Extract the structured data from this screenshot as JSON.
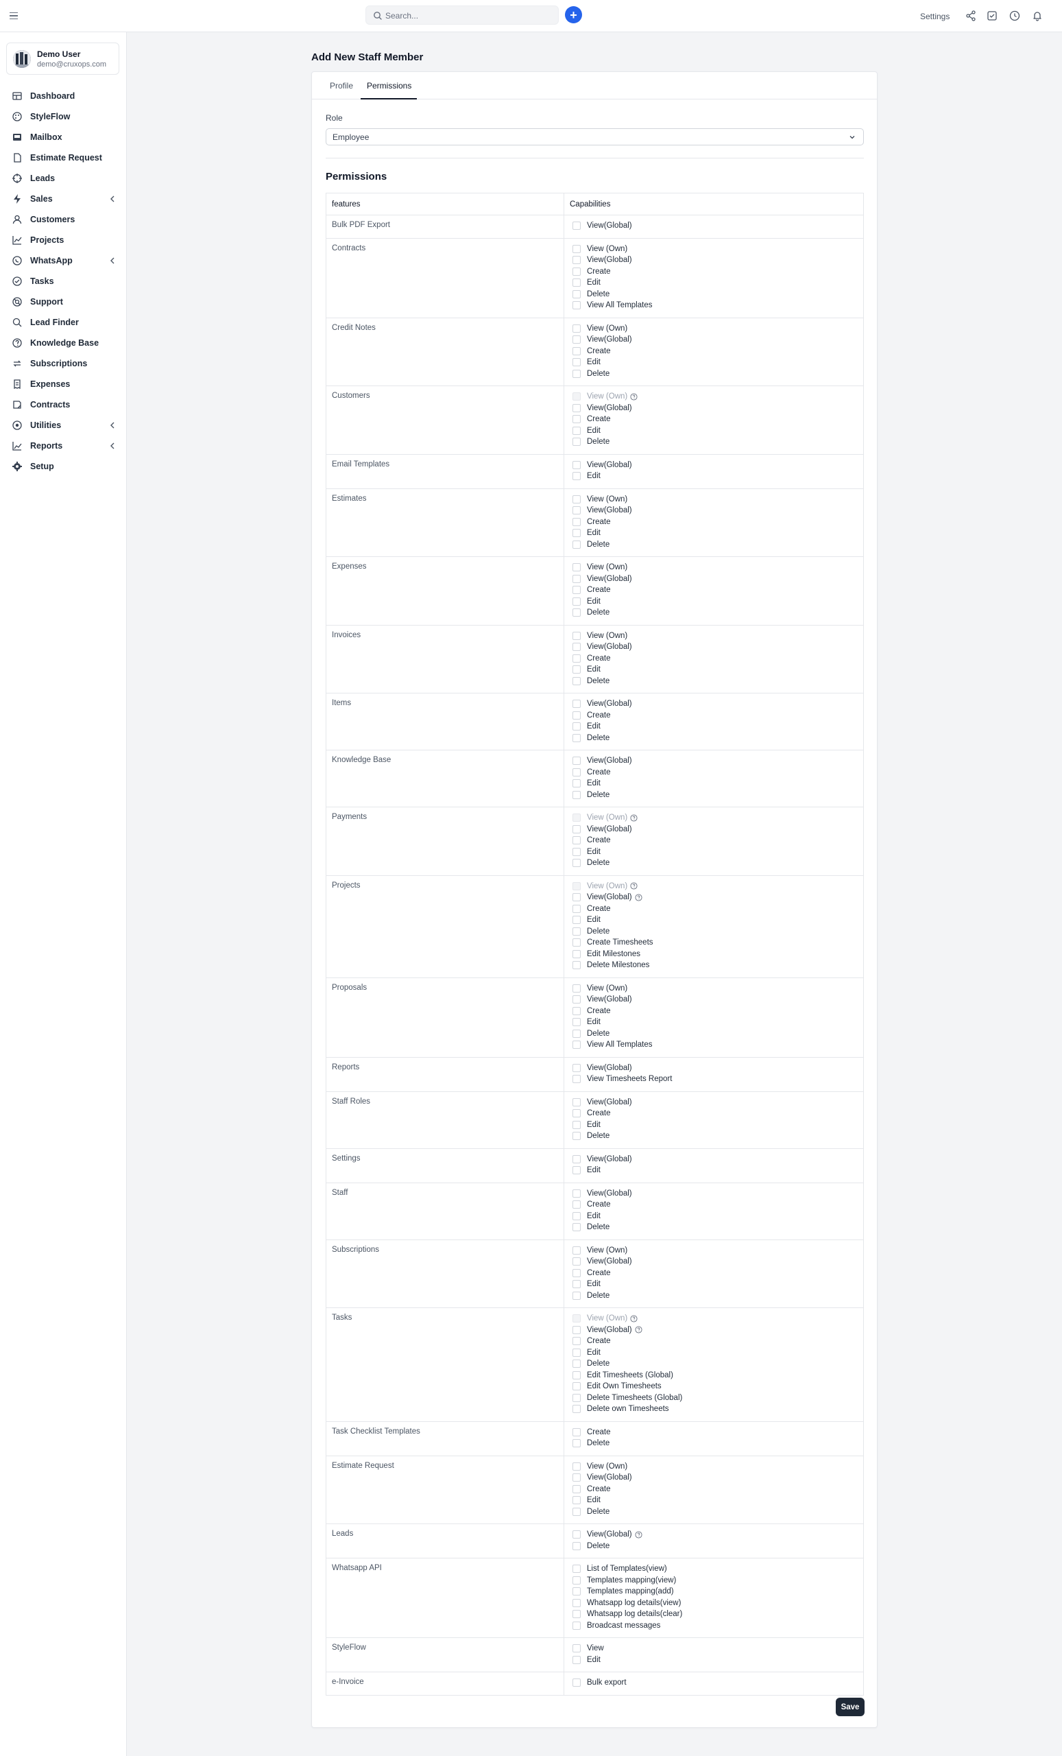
{
  "topbar": {
    "search_placeholder": "Search...",
    "settings_label": "Settings"
  },
  "user": {
    "name": "Demo User",
    "email": "demo@cruxops.com"
  },
  "sidebar": {
    "items": [
      {
        "label": "Dashboard",
        "icon": "dashboard-icon",
        "chevron": false
      },
      {
        "label": "StyleFlow",
        "icon": "palette-icon",
        "chevron": false
      },
      {
        "label": "Mailbox",
        "icon": "inbox-icon",
        "chevron": false
      },
      {
        "label": "Estimate Request",
        "icon": "file-icon",
        "chevron": false
      },
      {
        "label": "Leads",
        "icon": "target-icon",
        "chevron": false
      },
      {
        "label": "Sales",
        "icon": "bolt-icon",
        "chevron": true
      },
      {
        "label": "Customers",
        "icon": "user-icon",
        "chevron": false
      },
      {
        "label": "Projects",
        "icon": "chart-icon",
        "chevron": false
      },
      {
        "label": "WhatsApp",
        "icon": "whatsapp-icon",
        "chevron": true
      },
      {
        "label": "Tasks",
        "icon": "check-circle-icon",
        "chevron": false
      },
      {
        "label": "Support",
        "icon": "lifebuoy-icon",
        "chevron": false
      },
      {
        "label": "Lead Finder",
        "icon": "search-icon",
        "chevron": false
      },
      {
        "label": "Knowledge Base",
        "icon": "help-circle-icon",
        "chevron": false
      },
      {
        "label": "Subscriptions",
        "icon": "repeat-icon",
        "chevron": false
      },
      {
        "label": "Expenses",
        "icon": "receipt-icon",
        "chevron": false
      },
      {
        "label": "Contracts",
        "icon": "contract-icon",
        "chevron": false
      },
      {
        "label": "Utilities",
        "icon": "circle-dot-icon",
        "chevron": true
      },
      {
        "label": "Reports",
        "icon": "line-chart-icon",
        "chevron": true
      },
      {
        "label": "Setup",
        "icon": "gear-icon",
        "chevron": false
      }
    ]
  },
  "page": {
    "title": "Add New Staff Member",
    "tabs": [
      {
        "label": "Profile",
        "active": false
      },
      {
        "label": "Permissions",
        "active": true
      }
    ],
    "role_label": "Role",
    "role_value": "Employee",
    "permissions_title": "Permissions",
    "table_headers": {
      "features": "features",
      "capabilities": "Capabilities"
    },
    "save_label": "Save"
  },
  "permissions": [
    {
      "feature": "Bulk PDF Export",
      "caps": [
        {
          "label": "View(Global)"
        }
      ]
    },
    {
      "feature": "Contracts",
      "caps": [
        {
          "label": "View (Own)"
        },
        {
          "label": "View(Global)"
        },
        {
          "label": "Create"
        },
        {
          "label": "Edit"
        },
        {
          "label": "Delete"
        },
        {
          "label": "View All Templates"
        }
      ]
    },
    {
      "feature": "Credit Notes",
      "caps": [
        {
          "label": "View (Own)"
        },
        {
          "label": "View(Global)"
        },
        {
          "label": "Create"
        },
        {
          "label": "Edit"
        },
        {
          "label": "Delete"
        }
      ]
    },
    {
      "feature": "Customers",
      "caps": [
        {
          "label": "View (Own)",
          "disabled": true,
          "help": true
        },
        {
          "label": "View(Global)"
        },
        {
          "label": "Create"
        },
        {
          "label": "Edit"
        },
        {
          "label": "Delete"
        }
      ]
    },
    {
      "feature": "Email Templates",
      "caps": [
        {
          "label": "View(Global)"
        },
        {
          "label": "Edit"
        }
      ]
    },
    {
      "feature": "Estimates",
      "caps": [
        {
          "label": "View (Own)"
        },
        {
          "label": "View(Global)"
        },
        {
          "label": "Create"
        },
        {
          "label": "Edit"
        },
        {
          "label": "Delete"
        }
      ]
    },
    {
      "feature": "Expenses",
      "caps": [
        {
          "label": "View (Own)"
        },
        {
          "label": "View(Global)"
        },
        {
          "label": "Create"
        },
        {
          "label": "Edit"
        },
        {
          "label": "Delete"
        }
      ]
    },
    {
      "feature": "Invoices",
      "caps": [
        {
          "label": "View (Own)"
        },
        {
          "label": "View(Global)"
        },
        {
          "label": "Create"
        },
        {
          "label": "Edit"
        },
        {
          "label": "Delete"
        }
      ]
    },
    {
      "feature": "Items",
      "caps": [
        {
          "label": "View(Global)"
        },
        {
          "label": "Create"
        },
        {
          "label": "Edit"
        },
        {
          "label": "Delete"
        }
      ]
    },
    {
      "feature": "Knowledge Base",
      "caps": [
        {
          "label": "View(Global)"
        },
        {
          "label": "Create"
        },
        {
          "label": "Edit"
        },
        {
          "label": "Delete"
        }
      ]
    },
    {
      "feature": "Payments",
      "caps": [
        {
          "label": "View (Own)",
          "disabled": true,
          "help": true
        },
        {
          "label": "View(Global)"
        },
        {
          "label": "Create"
        },
        {
          "label": "Edit"
        },
        {
          "label": "Delete"
        }
      ]
    },
    {
      "feature": "Projects",
      "caps": [
        {
          "label": "View (Own)",
          "disabled": true,
          "help": true
        },
        {
          "label": "View(Global)",
          "help": true
        },
        {
          "label": "Create"
        },
        {
          "label": "Edit"
        },
        {
          "label": "Delete"
        },
        {
          "label": "Create Timesheets"
        },
        {
          "label": "Edit Milestones"
        },
        {
          "label": "Delete Milestones"
        }
      ]
    },
    {
      "feature": "Proposals",
      "caps": [
        {
          "label": "View (Own)"
        },
        {
          "label": "View(Global)"
        },
        {
          "label": "Create"
        },
        {
          "label": "Edit"
        },
        {
          "label": "Delete"
        },
        {
          "label": "View All Templates"
        }
      ]
    },
    {
      "feature": "Reports",
      "caps": [
        {
          "label": "View(Global)"
        },
        {
          "label": "View Timesheets Report"
        }
      ]
    },
    {
      "feature": "Staff Roles",
      "caps": [
        {
          "label": "View(Global)"
        },
        {
          "label": "Create"
        },
        {
          "label": "Edit"
        },
        {
          "label": "Delete"
        }
      ]
    },
    {
      "feature": "Settings",
      "caps": [
        {
          "label": "View(Global)"
        },
        {
          "label": "Edit"
        }
      ]
    },
    {
      "feature": "Staff",
      "caps": [
        {
          "label": "View(Global)"
        },
        {
          "label": "Create"
        },
        {
          "label": "Edit"
        },
        {
          "label": "Delete"
        }
      ]
    },
    {
      "feature": "Subscriptions",
      "caps": [
        {
          "label": "View (Own)"
        },
        {
          "label": "View(Global)"
        },
        {
          "label": "Create"
        },
        {
          "label": "Edit"
        },
        {
          "label": "Delete"
        }
      ]
    },
    {
      "feature": "Tasks",
      "caps": [
        {
          "label": "View (Own)",
          "disabled": true,
          "help": true
        },
        {
          "label": "View(Global)",
          "help": true
        },
        {
          "label": "Create"
        },
        {
          "label": "Edit"
        },
        {
          "label": "Delete"
        },
        {
          "label": "Edit Timesheets (Global)"
        },
        {
          "label": "Edit Own Timesheets"
        },
        {
          "label": "Delete Timesheets (Global)"
        },
        {
          "label": "Delete own Timesheets"
        }
      ]
    },
    {
      "feature": "Task Checklist Templates",
      "caps": [
        {
          "label": "Create"
        },
        {
          "label": "Delete"
        }
      ]
    },
    {
      "feature": "Estimate Request",
      "caps": [
        {
          "label": "View (Own)"
        },
        {
          "label": "View(Global)"
        },
        {
          "label": "Create"
        },
        {
          "label": "Edit"
        },
        {
          "label": "Delete"
        }
      ]
    },
    {
      "feature": "Leads",
      "caps": [
        {
          "label": "View(Global)",
          "help": true
        },
        {
          "label": "Delete"
        }
      ]
    },
    {
      "feature": "Whatsapp API",
      "caps": [
        {
          "label": "List of Templates(view)"
        },
        {
          "label": "Templates mapping(view)"
        },
        {
          "label": "Templates mapping(add)"
        },
        {
          "label": "Whatsapp log details(view)"
        },
        {
          "label": "Whatsapp log details(clear)"
        },
        {
          "label": "Broadcast messages"
        }
      ]
    },
    {
      "feature": "StyleFlow",
      "caps": [
        {
          "label": "View"
        },
        {
          "label": "Edit"
        }
      ]
    },
    {
      "feature": "e-Invoice",
      "caps": [
        {
          "label": "Bulk export"
        }
      ]
    }
  ]
}
